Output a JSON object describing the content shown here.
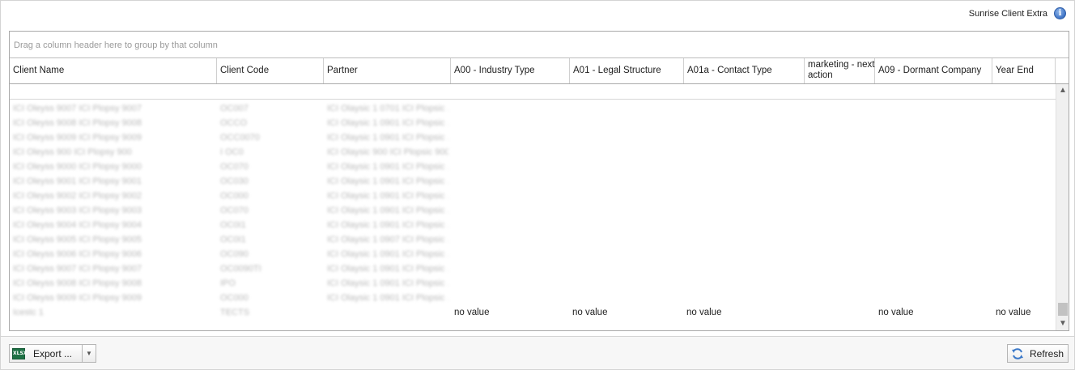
{
  "app_title": "Sunrise Client Extra",
  "group_hint": "Drag a column header here to group by that column",
  "columns": [
    {
      "label": "Client Name"
    },
    {
      "label": "Client Code"
    },
    {
      "label": "Partner"
    },
    {
      "label": "A00 - Industry Type"
    },
    {
      "label": "A01 - Legal Structure"
    },
    {
      "label": "A01a - Contact Type"
    },
    {
      "label": "marketing - next action"
    },
    {
      "label": "A09 - Dormant Company"
    },
    {
      "label": "Year End"
    }
  ],
  "rows": [
    {
      "client_name": "ICI Oleyss 9007 ICI Plopsy 9007",
      "client_code": "OC007",
      "partner": "ICI Olaysic 1 0701 ICI Plopsic ..."
    },
    {
      "client_name": "ICI Oleyss 9008 ICI Plopsy 9008",
      "client_code": "OCCO",
      "partner": "ICI Olaysic 1 0901 ICI Plopsic ..."
    },
    {
      "client_name": "ICI Oleyss 9009 ICI Plopsy 9009",
      "client_code": "OCC0070",
      "partner": "ICI Olaysic 1 0901 ICI Plopsic ..."
    },
    {
      "client_name": "ICI Oleyss 900 ICI Plopsy 900",
      "client_code": "I OC0",
      "partner": "ICI Olaysic 900 ICI Plopsic 900"
    },
    {
      "client_name": "ICI Oleyss 9000 ICI Plopsy 9000",
      "client_code": "OC070",
      "partner": "ICI Olaysic 1 0901 ICI Plopsic ..."
    },
    {
      "client_name": "ICI Oleyss 9001 ICI Plopsy 9001",
      "client_code": "OC030",
      "partner": "ICI Olaysic 1 0901 ICI Plopsic ..."
    },
    {
      "client_name": "ICI Oleyss 9002 ICI Plopsy 9002",
      "client_code": "OC000",
      "partner": "ICI Olaysic 1 0901 ICI Plopsic ..."
    },
    {
      "client_name": "ICI Oleyss 9003 ICI Plopsy 9003",
      "client_code": "OC070",
      "partner": "ICI Olaysic 1 0901 ICI Plopsic ..."
    },
    {
      "client_name": "ICI Oleyss 9004 ICI Plopsy 9004",
      "client_code": "OC0I1",
      "partner": "ICI Olaysic 1 0901 ICI Plopsic ..."
    },
    {
      "client_name": "ICI Oleyss 9005 ICI Plopsy 9005",
      "client_code": "OC0I1",
      "partner": "ICI Olaysic 1 0907 ICI Plopsic ..."
    },
    {
      "client_name": "ICI Oleyss 9006 ICI Plopsy 9006",
      "client_code": "OC090",
      "partner": "ICI Olaysic 1 0901 ICI Plopsic ..."
    },
    {
      "client_name": "ICI Oleyss 9007 ICI Plopsy 9007",
      "client_code": "OC0090TI",
      "partner": "ICI Olaysic 1 0901 ICI Plopsic ..."
    },
    {
      "client_name": "ICI Oleyss 9008 ICI Plopsy 9008",
      "client_code": "IPO",
      "partner": "ICI Olaysic 1 0901 ICI Plopsic ..."
    },
    {
      "client_name": "ICI Oleyss 9009 ICI Plopsy 9009",
      "client_code": "OC000",
      "partner": "ICI Olaysic 1 0901 ICI Plopsic ..."
    }
  ],
  "last_row": {
    "client_name": "Icestc 1",
    "client_code": "TECTS",
    "industry_type": "no value",
    "legal_structure": "no value",
    "contact_type": "no value",
    "dormant_company": "no value",
    "year_end": "no value"
  },
  "footer": {
    "export_label": "Export ...",
    "export_icon_text": "XLSX",
    "refresh_label": "Refresh"
  },
  "colors": {
    "grid_border": "#a9a9a9",
    "blurred_text": "#b9b9b9",
    "excel_green": "#1e7145",
    "info_blue": "#3f74c6"
  },
  "icons": [
    "info-icon",
    "excel-icon",
    "chevron-down-icon",
    "refresh-icon",
    "scroll-up-icon",
    "scroll-down-icon"
  ]
}
